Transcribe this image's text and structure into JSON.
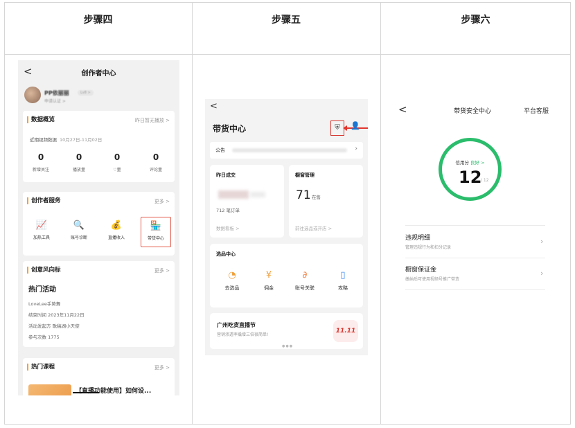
{
  "columns": [
    {
      "title": "步骤四"
    },
    {
      "title": "步骤五"
    },
    {
      "title": "步骤六"
    }
  ],
  "step4": {
    "back": "<",
    "title": "创作者中心",
    "profile": {
      "name": "PP依丽丽",
      "level": "Lv8 >",
      "sub": "申请认证 >"
    },
    "data_overview": {
      "title": "数据概览",
      "more": "昨日暂无播放 >",
      "range_label": "近期视频数据",
      "range": "10月27日-11月02日",
      "stats": [
        {
          "value": "0",
          "label": "新增关注"
        },
        {
          "value": "0",
          "label": "播放量"
        },
        {
          "value": "0",
          "label": "♡量"
        },
        {
          "value": "0",
          "label": "评论量"
        }
      ]
    },
    "creator_services": {
      "title": "创作者服务",
      "more": "更多 >",
      "items": [
        {
          "icon": "📈",
          "label": "加热工具"
        },
        {
          "icon": "🔍",
          "label": "账号诊断"
        },
        {
          "icon": "💰",
          "label": "直播收入"
        },
        {
          "icon": "🏪",
          "label": "带货中心"
        }
      ]
    },
    "trend": {
      "title": "创意风向标",
      "more": "更多 >",
      "event_title": "热门活动",
      "lines": [
        "LoveLee手势舞",
        "结束时间  2023年11月22日",
        "活动发起方  歌稿湖小天使",
        "参与次数  1775"
      ]
    },
    "courses": {
      "title": "热门课程",
      "more": "更多 >",
      "course_text": "【直播功能使用】如何设..."
    }
  },
  "step5": {
    "back": "<",
    "title": "带货中心",
    "shield_icon": "⛨",
    "person_icon": "👤",
    "notice_label": "公告",
    "yesterday": {
      "title": "昨日成交",
      "sub": "712 笔订单",
      "link": "数据看板 >"
    },
    "window": {
      "title": "橱窗管理",
      "value": "71",
      "unit": "在售",
      "link": "前往选品或开店 >"
    },
    "selection": {
      "title": "选品中心",
      "items": [
        {
          "icon": "◔",
          "label": "去选品",
          "color": "#f0a03c"
        },
        {
          "icon": "¥",
          "label": "佣金",
          "color": "#f0a03c"
        },
        {
          "icon": "∂",
          "label": "账号关联",
          "color": "#f07c3c"
        },
        {
          "icon": "▯",
          "label": "攻略",
          "color": "#3c8cf0"
        }
      ]
    },
    "banner": {
      "title": "广州吃货直播节",
      "sub": "营销渗透率撬增三倍很简单!",
      "badge": "11.11"
    }
  },
  "step6": {
    "back": "<",
    "title": "带货安全中心",
    "customer_service": "平台客服",
    "credit_label": "信用分",
    "credit_status": "良好 >",
    "score": "12",
    "score_max": "/ 12",
    "rows": [
      {
        "title": "违规明细",
        "sub": "管理违规行为和扣分记录"
      },
      {
        "title": "橱窗保证金",
        "sub": "缴纳后可使用视频号推广带货"
      }
    ]
  }
}
